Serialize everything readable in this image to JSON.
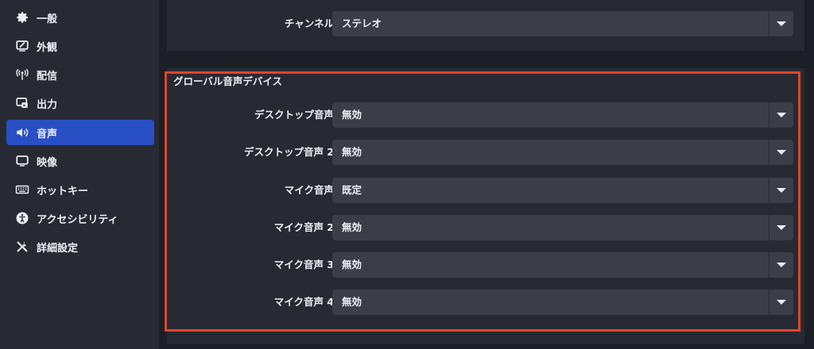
{
  "sidebar": {
    "items": [
      {
        "label": "一般",
        "icon": "gear-icon"
      },
      {
        "label": "外観",
        "icon": "appearance-icon"
      },
      {
        "label": "配信",
        "icon": "antenna-icon"
      },
      {
        "label": "出力",
        "icon": "output-icon"
      },
      {
        "label": "音声",
        "icon": "speaker-icon",
        "active": true
      },
      {
        "label": "映像",
        "icon": "monitor-icon"
      },
      {
        "label": "ホットキー",
        "icon": "keyboard-icon"
      },
      {
        "label": "アクセシビリティ",
        "icon": "accessibility-icon"
      },
      {
        "label": "詳細設定",
        "icon": "tools-icon"
      }
    ]
  },
  "general": {
    "channel": {
      "label": "チャンネル",
      "value": "ステレオ"
    }
  },
  "devices": {
    "title": "グローバル音声デバイス",
    "rows": [
      {
        "label": "デスクトップ音声",
        "value": "無効"
      },
      {
        "label": "デスクトップ音声 2",
        "value": "無効"
      },
      {
        "label": "マイク音声",
        "value": "既定"
      },
      {
        "label": "マイク音声 2",
        "value": "無効"
      },
      {
        "label": "マイク音声 3",
        "value": "無効"
      },
      {
        "label": "マイク音声 4",
        "value": "無効"
      }
    ]
  },
  "colors": {
    "accent": "#284fc4",
    "highlight": "#e0452b"
  }
}
